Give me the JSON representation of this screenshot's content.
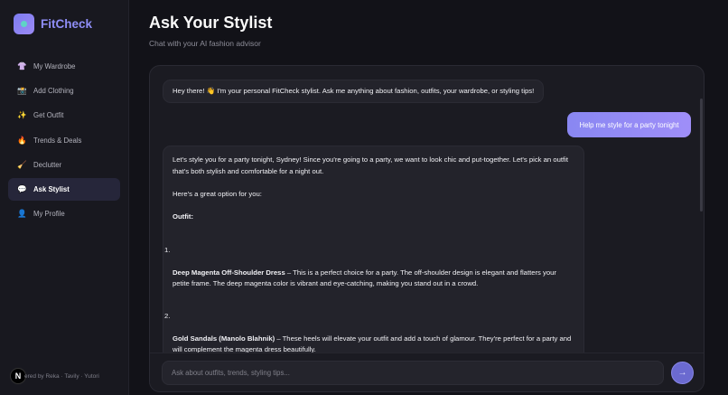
{
  "brand": {
    "name": "FitCheck"
  },
  "sidebar": {
    "items": [
      {
        "label": "My Wardrobe",
        "icon": "👚"
      },
      {
        "label": "Add Clothing",
        "icon": "📸"
      },
      {
        "label": "Get Outfit",
        "icon": "✨"
      },
      {
        "label": "Trends & Deals",
        "icon": "🔥"
      },
      {
        "label": "Declutter",
        "icon": "🧹"
      },
      {
        "label": "Ask Stylist",
        "icon": "💬",
        "active": true
      },
      {
        "label": "My Profile",
        "icon": "👤"
      }
    ],
    "footer": {
      "badge": "N",
      "text": "ered by Reka · Tavily · Yutori"
    }
  },
  "page": {
    "title": "Ask Your Stylist",
    "subtitle": "Chat with your AI fashion advisor"
  },
  "chat": {
    "greeting": "Hey there! 👋 I'm your personal FitCheck stylist. Ask me anything about fashion, outfits, your wardrobe, or styling tips!",
    "user_message": "Help me style for a party tonight",
    "response": {
      "intro": "Let's style you for a party tonight, Sydney! Since you're going to a party, we want to look chic and put-together. Let's pick an outfit that's both stylish and comfortable for a night out.",
      "option_line": "Here's a great option for you:",
      "outfit_heading": "Outfit:",
      "items": [
        {
          "num": "1.",
          "name": "Deep Magenta Off-Shoulder Dress",
          "desc": " – This is a perfect choice for a party. The off-shoulder design is elegant and flatters your petite frame. The deep magenta color is vibrant and eye-catching, making you stand out in a crowd."
        },
        {
          "num": "2.",
          "name": "Gold Sandals (Manolo Blahnik)",
          "desc": " – These heels will elevate your outfit and add a touch of glamour. They're perfect for a party and will complement the magenta dress beautifully."
        }
      ]
    },
    "input": {
      "placeholder": "Ask about outfits, trends, styling tips...",
      "value": ""
    },
    "send_icon": "→"
  },
  "colors": {
    "accent": "#8f8ef7",
    "user_bubble": "#9896f5",
    "background": "#121218",
    "panel": "#1b1b22"
  }
}
